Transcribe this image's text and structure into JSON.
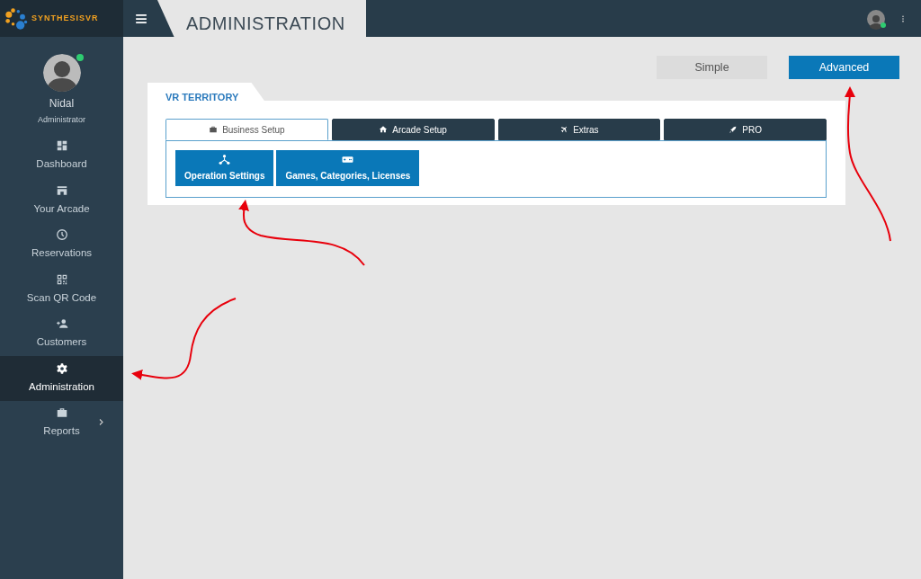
{
  "brand": "SYNTHESISVR",
  "page_title": "ADMINISTRATION",
  "user": {
    "name": "Nidal",
    "role": "Administrator",
    "online": true
  },
  "topbar_user": {
    "online": true
  },
  "nav": [
    {
      "label": "Dashboard",
      "selected": false,
      "submenu": false
    },
    {
      "label": "Your Arcade",
      "selected": false,
      "submenu": false
    },
    {
      "label": "Reservations",
      "selected": false,
      "submenu": false
    },
    {
      "label": "Scan QR Code",
      "selected": false,
      "submenu": false
    },
    {
      "label": "Customers",
      "selected": false,
      "submenu": false
    },
    {
      "label": "Administration",
      "selected": true,
      "submenu": false
    },
    {
      "label": "Reports",
      "selected": false,
      "submenu": true
    }
  ],
  "modes": [
    {
      "label": "Simple",
      "selected": false
    },
    {
      "label": "Advanced",
      "selected": true
    }
  ],
  "card": {
    "title": "VR TERRITORY",
    "tabs": [
      {
        "label": "Business Setup",
        "selected": true
      },
      {
        "label": "Arcade Setup",
        "selected": false
      },
      {
        "label": "Extras",
        "selected": false
      },
      {
        "label": "PRO",
        "selected": false
      }
    ],
    "actions": [
      {
        "label": "Operation Settings"
      },
      {
        "label": "Games, Categories, Licenses"
      }
    ]
  }
}
